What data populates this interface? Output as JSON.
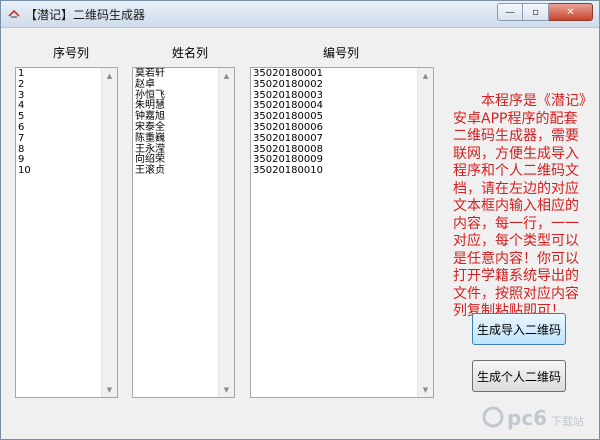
{
  "window": {
    "title": "【潜记】二维码生成器"
  },
  "controls": {
    "minimize": "—",
    "maximize": "▫",
    "close": "✕"
  },
  "columns": {
    "serial": {
      "label": "序号列",
      "content": "1\n2\n3\n4\n5\n6\n7\n8\n9\n10"
    },
    "name": {
      "label": "姓名列",
      "content": "莫若轩\n赵卓\n孙恒飞\n朱明慧\n钟嘉旭\n宋泰全\n陈重巍\n王永滢\n向绍荣\n王滚贞"
    },
    "number": {
      "label": "编号列",
      "content": "35020180001\n35020180002\n35020180003\n35020180004\n35020180005\n35020180006\n35020180007\n35020180008\n35020180009\n35020180010"
    }
  },
  "description": "　　本程序是《潜记》安卓APP程序的配套二维码生成器，需要联网，方便生成导入程序和个人二维码文档，请在左边的对应文本框内输入相应的内容，每一行，一一对应，每个类型可以是任意内容！你可以打开学籍系统导出的文件，按照对应内容列复制粘贴即可！",
  "buttons": {
    "import_qr": "生成导入二维码",
    "personal_qr": "生成个人二维码"
  },
  "watermark": {
    "brand": "pc6",
    "site": "下载站"
  },
  "colors": {
    "description_text": "#d42020",
    "focused_button": "#3c7fb1"
  }
}
